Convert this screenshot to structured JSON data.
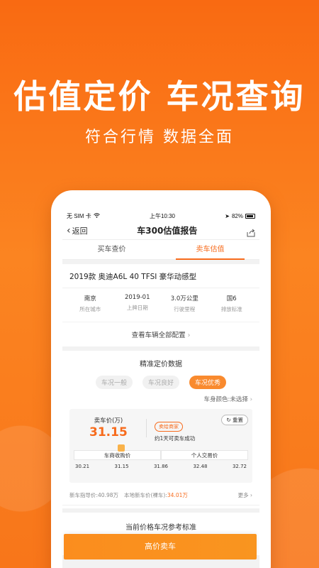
{
  "hero": {
    "headline": "估值定价 车况查询",
    "subline": "符合行情 数据全面"
  },
  "status_bar": {
    "carrier": "无 SIM 卡",
    "time": "上午10:30",
    "battery": "82%"
  },
  "nav": {
    "back_label": "返回",
    "title": "车300估值报告"
  },
  "tabs": [
    {
      "label": "买车查价",
      "active": false
    },
    {
      "label": "卖车估值",
      "active": true
    }
  ],
  "car": {
    "title": "2019款 奥迪A6L 40 TFSI 豪华动感型",
    "specs": [
      {
        "value": "南京",
        "label": "所在城市"
      },
      {
        "value": "2019-01",
        "label": "上牌日期"
      },
      {
        "value": "3.0万公里",
        "label": "行驶里程"
      },
      {
        "value": "国6",
        "label": "排放标准"
      }
    ],
    "config_link": "查看车辆全部配置"
  },
  "pricing": {
    "section_title": "精准定价数据",
    "conditions": [
      {
        "label": "车况一般",
        "active": false
      },
      {
        "label": "车况良好",
        "active": false
      },
      {
        "label": "车况优秀",
        "active": true
      }
    ],
    "color_select": "车身颜色:未选择",
    "sell_label": "卖车价(万)",
    "sell_price": "31.15",
    "merchant_badge": "卖给商家",
    "merchant_note": "约1天可卖车成功",
    "reset_label": "重置",
    "scale_segments": [
      "车商收购价",
      "个人交易价"
    ],
    "scale_ticks": [
      "30.21",
      "31.15",
      "31.86",
      "32.48",
      "32.72"
    ],
    "guide_price_text": "新车指导价:40.98万",
    "local_price_label": "本地新车价(裸车):",
    "local_price_value": "34.01万",
    "more_label": "更多",
    "ref_title": "当前价格车况参考标准"
  },
  "cta": {
    "label": "高价卖车"
  },
  "colors": {
    "accent": "#f76b1c",
    "background": "#f97a1a"
  }
}
